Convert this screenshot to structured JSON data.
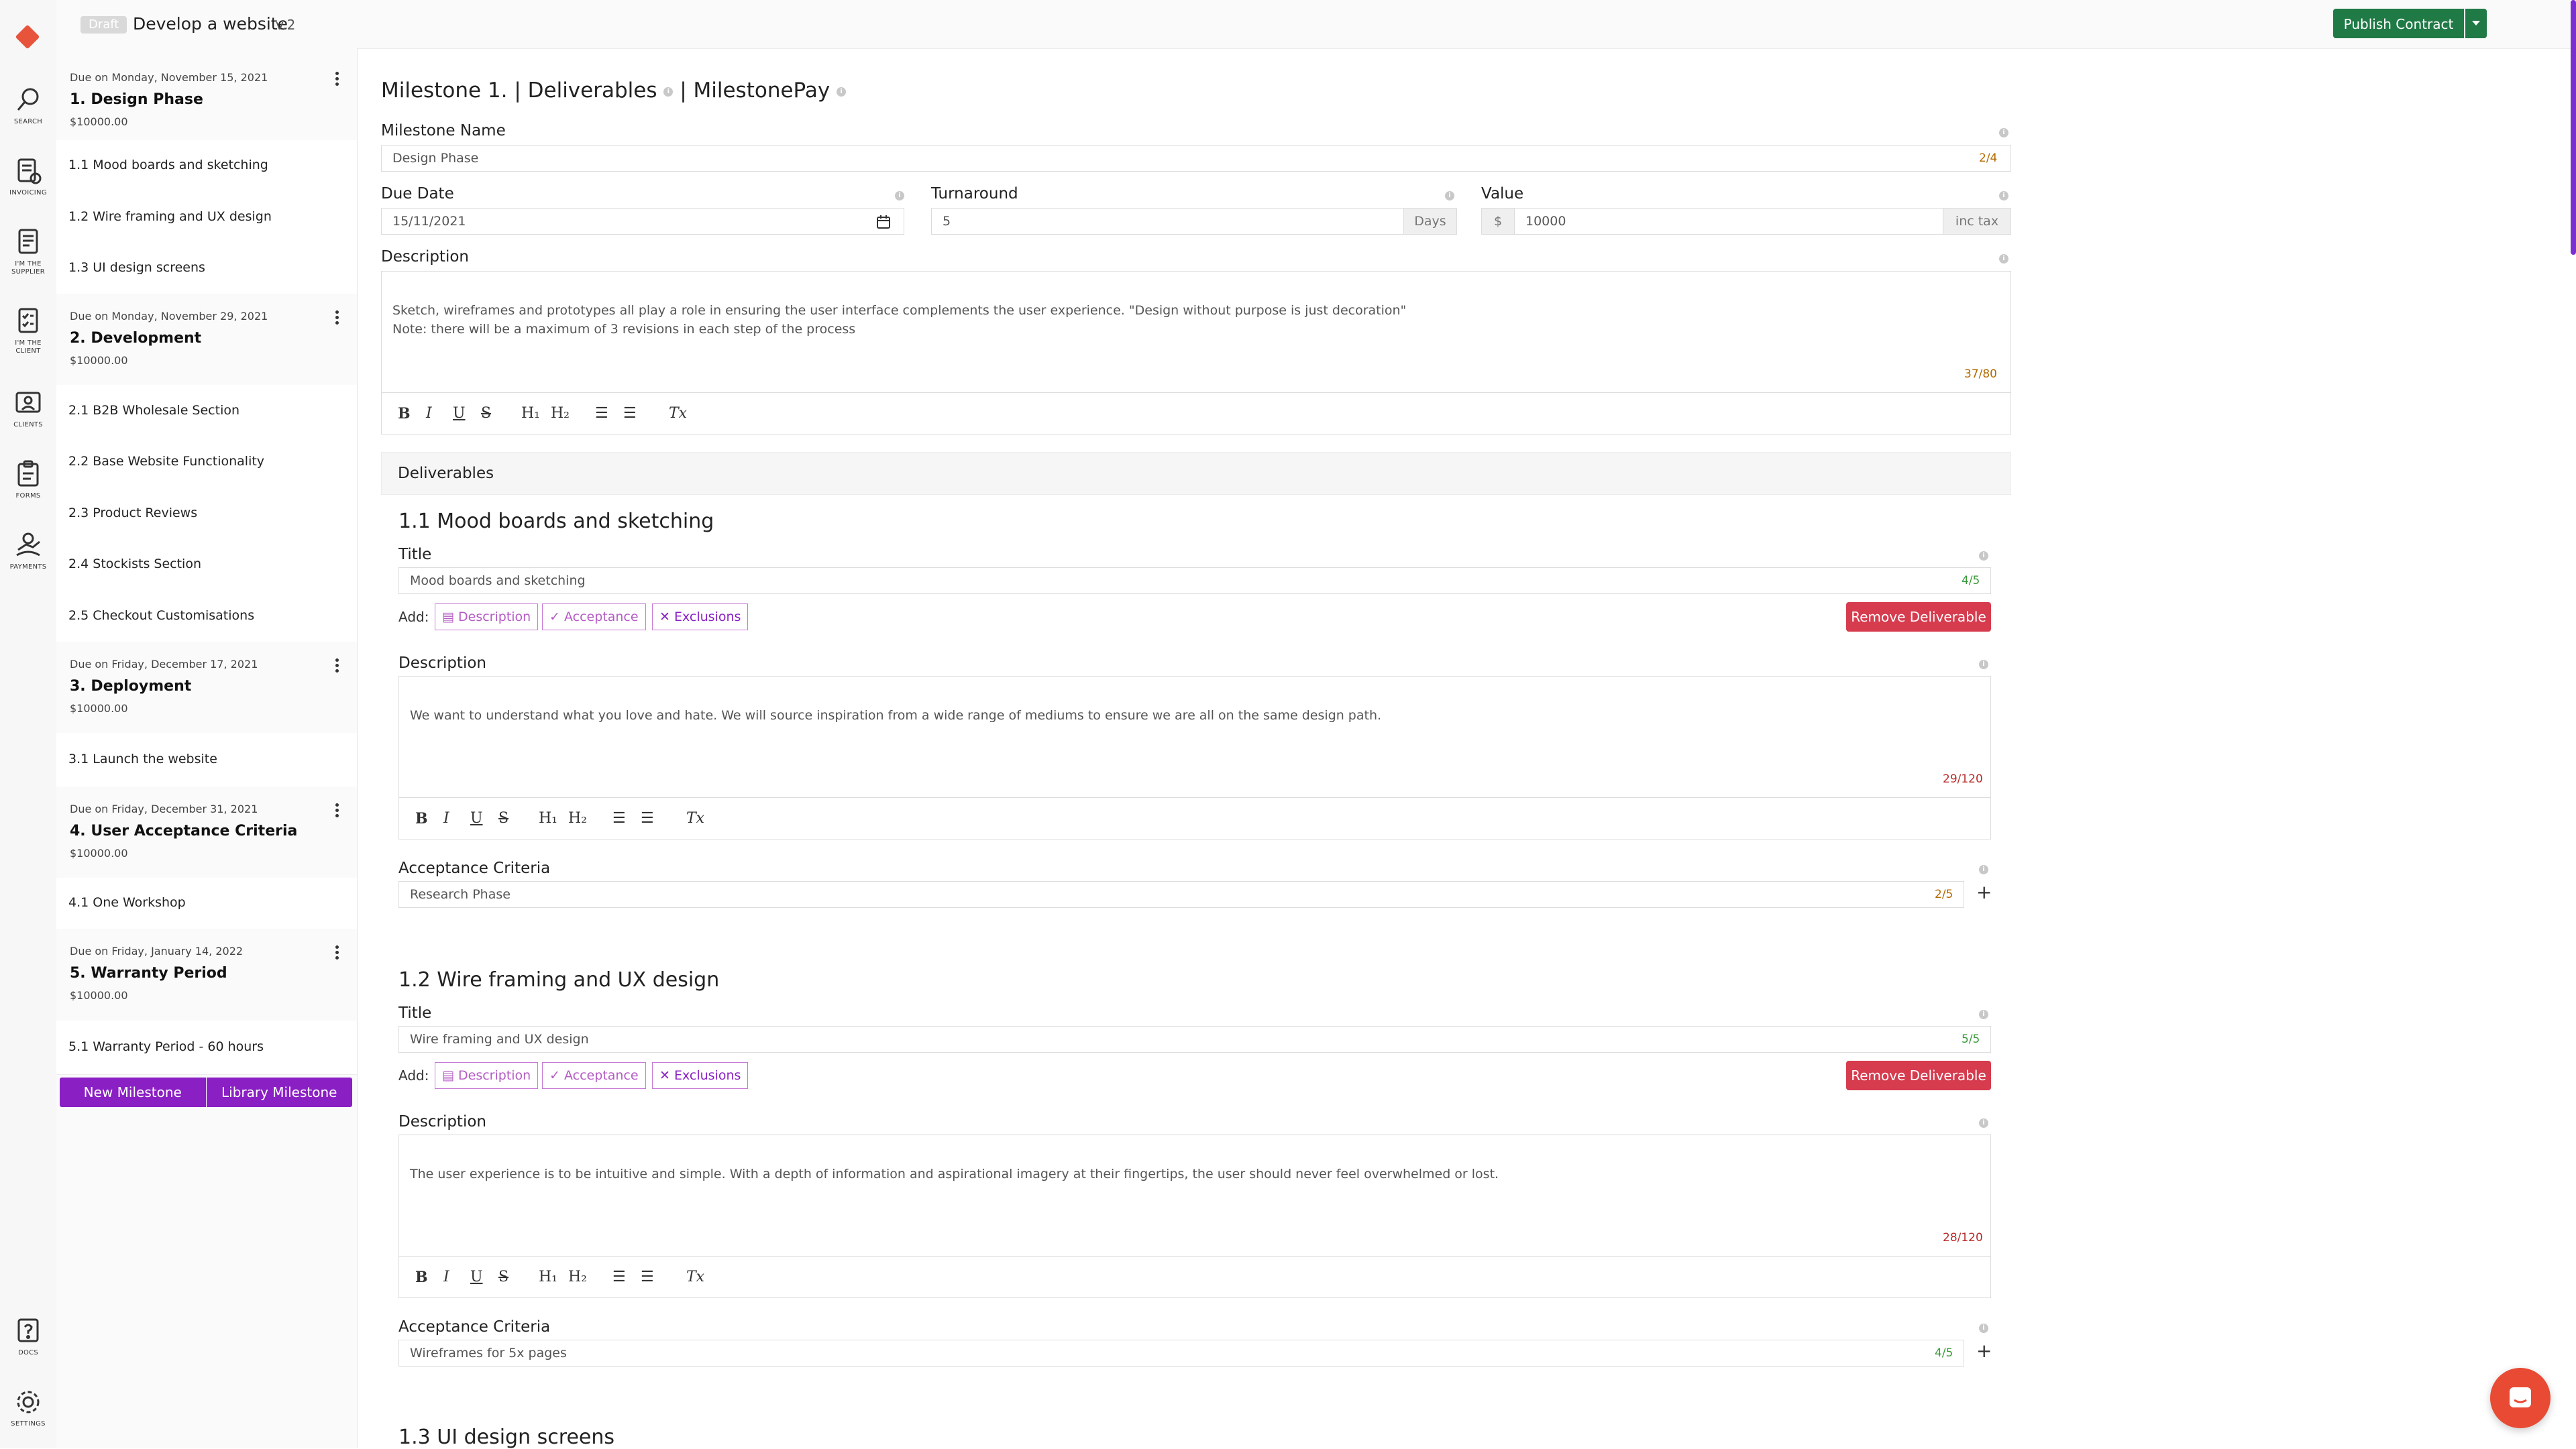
{
  "app": {
    "draft_badge": "Draft",
    "title": "Develop a website",
    "version": "v.2",
    "publish_label": "Publish Contract"
  },
  "rail": {
    "search": "Search",
    "invoicing": "Invoicing",
    "supplier": "I'm the supplier",
    "client": "I'm the client",
    "clients": "Clients",
    "forms": "Forms",
    "payments": "Payments",
    "docs": "Docs",
    "settings": "Settings"
  },
  "sidebar": {
    "milestones": [
      {
        "due": "Due on Monday, November 15, 2021",
        "name": "1. Design Phase",
        "amount": "$10000.00",
        "items": [
          "1.1 Mood boards and sketching",
          "1.2 Wire framing and UX design",
          "1.3 UI design screens"
        ]
      },
      {
        "due": "Due on Monday, November 29, 2021",
        "name": "2. Development",
        "amount": "$10000.00",
        "items": [
          "2.1 B2B Wholesale Section",
          "2.2 Base Website Functionality",
          "2.3 Product Reviews",
          "2.4 Stockists Section",
          "2.5 Checkout Customisations"
        ]
      },
      {
        "due": "Due on Friday, December 17, 2021",
        "name": "3. Deployment",
        "amount": "$10000.00",
        "items": [
          "3.1 Launch the website"
        ]
      },
      {
        "due": "Due on Friday, December 31, 2021",
        "name": "4. User Acceptance Criteria",
        "amount": "$10000.00",
        "items": [
          "4.1 One Workshop"
        ]
      },
      {
        "due": "Due on Friday, January 14, 2022",
        "name": "5. Warranty Period",
        "amount": "$10000.00",
        "items": [
          "5.1 Warranty Period - 60 hours"
        ]
      }
    ],
    "new_milestone": "New Milestone",
    "library_milestone": "Library Milestone"
  },
  "form": {
    "heading_milestone": "Milestone 1.",
    "heading_deliverables": "Deliverables",
    "heading_pay": "MilestonePay",
    "name_label": "Milestone Name",
    "name_value": "Design Phase",
    "name_counter": "2/4",
    "due_label": "Due Date",
    "due_value": "15/11/2021",
    "turnaround_label": "Turnaround",
    "turnaround_value": "5",
    "turnaround_unit": "Days",
    "value_label": "Value",
    "value_prefix": "$",
    "value_value": "10000",
    "value_suffix": "inc tax",
    "desc_label": "Description",
    "desc_value": "Sketch, wireframes and prototypes all play a role in ensuring the user interface complements the user experience. \"Design without purpose is just decoration\"\n Note: there will be a maximum of 3 revisions in each step of the process",
    "desc_counter": "37/80",
    "deliverables_header": "Deliverables"
  },
  "editor": {
    "bold": "B",
    "italic": "I",
    "underline": "U",
    "strike": "S",
    "h1": "H₁",
    "h2": "H₂",
    "ol": "☰",
    "ul": "☰",
    "clear": "Tx"
  },
  "deliverables": [
    {
      "heading": "1.1 Mood boards and sketching",
      "title_label": "Title",
      "title_value": "Mood boards and sketching",
      "title_counter": "4/5",
      "add_label": "Add:",
      "add_description": "Description",
      "add_acceptance": "Acceptance",
      "add_exclusions": "Exclusions",
      "remove_label": "Remove Deliverable",
      "desc_label": "Description",
      "desc_value": "We want to understand what you love and hate. We will source inspiration from a wide range of mediums to ensure we are all on the same design path.",
      "desc_counter": "29/120",
      "acc_label": "Acceptance Criteria",
      "acc_value": "Research Phase",
      "acc_counter": "2/5"
    },
    {
      "heading": "1.2 Wire framing and UX design",
      "title_label": "Title",
      "title_value": "Wire framing and UX design",
      "title_counter": "5/5",
      "add_label": "Add:",
      "add_description": "Description",
      "add_acceptance": "Acceptance",
      "add_exclusions": "Exclusions",
      "remove_label": "Remove Deliverable",
      "desc_label": "Description",
      "desc_value": "The user experience is to be intuitive and simple. With a depth of information and aspirational imagery at their fingertips, the user should never feel overwhelmed or lost.",
      "desc_counter": "28/120",
      "acc_label": "Acceptance Criteria",
      "acc_value": "Wireframes for 5x pages",
      "acc_counter": "4/5"
    }
  ],
  "next_deliverable_heading": "1.3 UI design screens",
  "colors": {
    "brand": "#e8533b",
    "primary": "#8a1fc4",
    "publish": "#1f7a46",
    "danger": "#d63b4e"
  }
}
